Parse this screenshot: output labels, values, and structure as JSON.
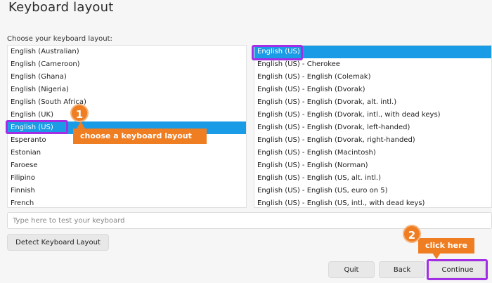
{
  "page": {
    "title": "Keyboard layout",
    "prompt": "Choose your keyboard layout:"
  },
  "layouts": [
    "English (Australian)",
    "English (Cameroon)",
    "English (Ghana)",
    "English (Nigeria)",
    "English (South Africa)",
    "English (UK)",
    "English (US)",
    "Esperanto",
    "Estonian",
    "Faroese",
    "Filipino",
    "Finnish",
    "French"
  ],
  "selected_layout": "English (US)",
  "variants": [
    "English (US)",
    "English (US) - Cherokee",
    "English (US) - English (Colemak)",
    "English (US) - English (Dvorak)",
    "English (US) - English (Dvorak, alt. intl.)",
    "English (US) - English (Dvorak, intl., with dead keys)",
    "English (US) - English (Dvorak, left-handed)",
    "English (US) - English (Dvorak, right-handed)",
    "English (US) - English (Macintosh)",
    "English (US) - English (Norman)",
    "English (US) - English (US, alt. intl.)",
    "English (US) - English (US, euro on 5)",
    "English (US) - English (US, intl., with dead keys)"
  ],
  "selected_variant": "English (US)",
  "test_input": {
    "value": "",
    "placeholder": "Type here to test your keyboard"
  },
  "buttons": {
    "detect": "Detect Keyboard Layout",
    "quit": "Quit",
    "back": "Back",
    "continue": "Continue"
  },
  "annotations": {
    "step1_number": "1",
    "step1_text": "choose a keyboard layout",
    "step2_number": "2",
    "step2_text": "click here"
  },
  "colors": {
    "selection": "#1a9be6",
    "highlight_outline": "#a22ee6",
    "callout": "#ef7d22"
  }
}
